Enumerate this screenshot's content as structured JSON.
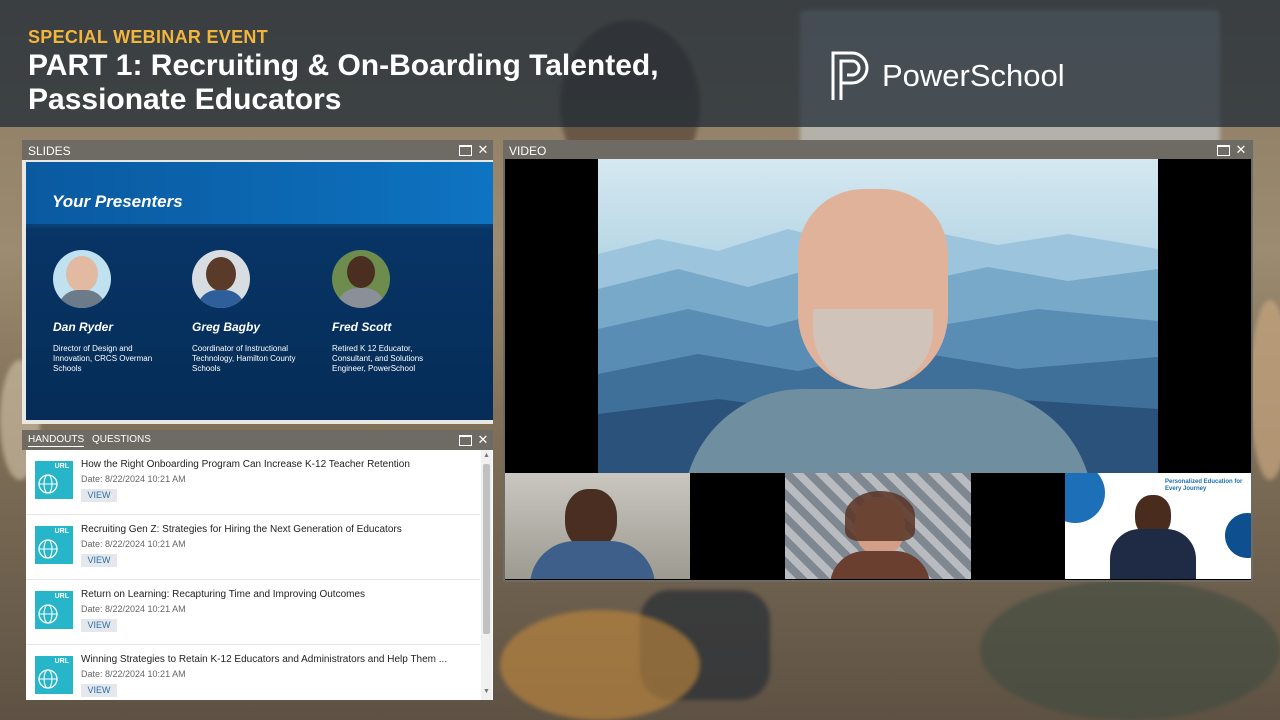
{
  "header": {
    "eyebrow": "SPECIAL WEBINAR EVENT",
    "title": "PART 1: Recruiting & On-Boarding Talented, Passionate Educators",
    "logo_text": "PowerSchool"
  },
  "colors": {
    "eyebrow": "#f3b63c",
    "slide_blue": "#073566",
    "url_icon": "#27b6c9",
    "panel_bar": "#6e6a64"
  },
  "slides_panel": {
    "label": "SLIDES",
    "heading": "Your Presenters",
    "presenters": [
      {
        "name": "Dan Ryder",
        "role": "Director of Design and Innovation, CRCS Overman Schools"
      },
      {
        "name": "Greg Bagby",
        "role": "Coordinator of Instructional Technology, Hamilton County Schools"
      },
      {
        "name": "Fred Scott",
        "role": "Retired K 12 Educator, Consultant, and Solutions Engineer, PowerSchool"
      }
    ]
  },
  "video_panel": {
    "label": "VIDEO",
    "tile3_banner": "Personalized Education for Every Journey"
  },
  "handouts_panel": {
    "tabs": [
      "HANDOUTS",
      "QUESTIONS"
    ],
    "items": [
      {
        "icon_label": "URL",
        "title": "How the Right Onboarding Program Can Increase K-12 Teacher Retention",
        "date": "Date: 8/22/2024 10:21 AM",
        "action": "VIEW"
      },
      {
        "icon_label": "URL",
        "title": "Recruiting Gen Z: Strategies for Hiring the Next Generation of Educators",
        "date": "Date: 8/22/2024 10:21 AM",
        "action": "VIEW"
      },
      {
        "icon_label": "URL",
        "title": "Return on Learning: Recapturing Time and Improving Outcomes",
        "date": "Date: 8/22/2024 10:21 AM",
        "action": "VIEW"
      },
      {
        "icon_label": "URL",
        "title": "Winning Strategies to Retain K-12 Educators and Administrators and Help Them ...",
        "date": "Date: 8/22/2024 10:21 AM",
        "action": "VIEW"
      }
    ]
  }
}
